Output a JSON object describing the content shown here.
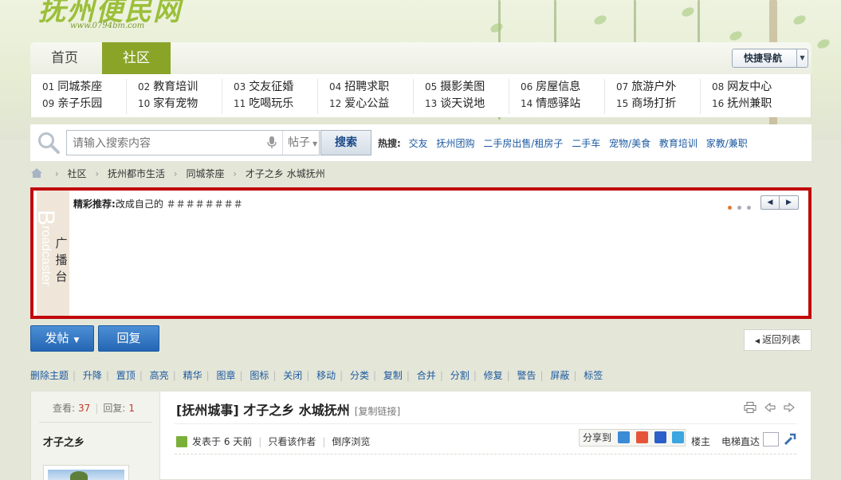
{
  "site": {
    "logo_text": "抚州便民网",
    "logo_url": "www.0794bm.com"
  },
  "nav": {
    "tabs": [
      {
        "label": "首页"
      },
      {
        "label": "社区"
      }
    ],
    "quick_nav": "快捷导航"
  },
  "categories": [
    {
      "num": "01",
      "label": "同城茶座"
    },
    {
      "num": "09",
      "label": "亲子乐园"
    },
    {
      "num": "02",
      "label": "教育培训"
    },
    {
      "num": "10",
      "label": "家有宠物"
    },
    {
      "num": "03",
      "label": "交友征婚"
    },
    {
      "num": "11",
      "label": "吃喝玩乐"
    },
    {
      "num": "04",
      "label": "招聘求职"
    },
    {
      "num": "12",
      "label": "爱心公益"
    },
    {
      "num": "05",
      "label": "摄影美图"
    },
    {
      "num": "13",
      "label": "谈天说地"
    },
    {
      "num": "06",
      "label": "房屋信息"
    },
    {
      "num": "14",
      "label": "情感驿站"
    },
    {
      "num": "07",
      "label": "旅游户外"
    },
    {
      "num": "15",
      "label": "商场打折"
    },
    {
      "num": "08",
      "label": "网友中心"
    },
    {
      "num": "16",
      "label": "抚州兼职"
    }
  ],
  "search": {
    "placeholder": "请输入搜索内容",
    "scope": "帖子",
    "button": "搜索",
    "hot_label": "热搜:",
    "hot_links": [
      "交友",
      "抚州团购",
      "二手房出售/租房子",
      "二手车",
      "宠物/美食",
      "教育培训",
      "家教/兼职"
    ]
  },
  "breadcrumb": [
    "社区",
    "抚州都市生活",
    "同城茶座",
    "才子之乡 水城抚州"
  ],
  "broadcaster": {
    "en_initial": "B",
    "en_rest": "roadcaster",
    "cn": [
      "广",
      "播",
      "台"
    ],
    "label": "精彩推荐:",
    "text": "改成自己的 ＃＃＃＃＃＃＃＃"
  },
  "actions": {
    "post": "发帖",
    "reply": "回复",
    "back": "返回列表"
  },
  "mod_actions": [
    "删除主题",
    "升降",
    "置顶",
    "高亮",
    "精华",
    "图章",
    "图标",
    "关闭",
    "移动",
    "分类",
    "复制",
    "合并",
    "分割",
    "修复",
    "警告",
    "屏蔽",
    "标签"
  ],
  "post": {
    "views_label": "查看:",
    "views": "37",
    "replies_label": "回复:",
    "replies": "1",
    "author": "才子之乡",
    "title": "[抚州城事] 才子之乡 水城抚州",
    "copy_link": "[复制链接]",
    "posted": "发表于 6 天前",
    "only_author": "只看该作者",
    "reverse": "倒序浏览",
    "share_label": "分享到",
    "floor": "楼主",
    "elevator": "电梯直达"
  }
}
